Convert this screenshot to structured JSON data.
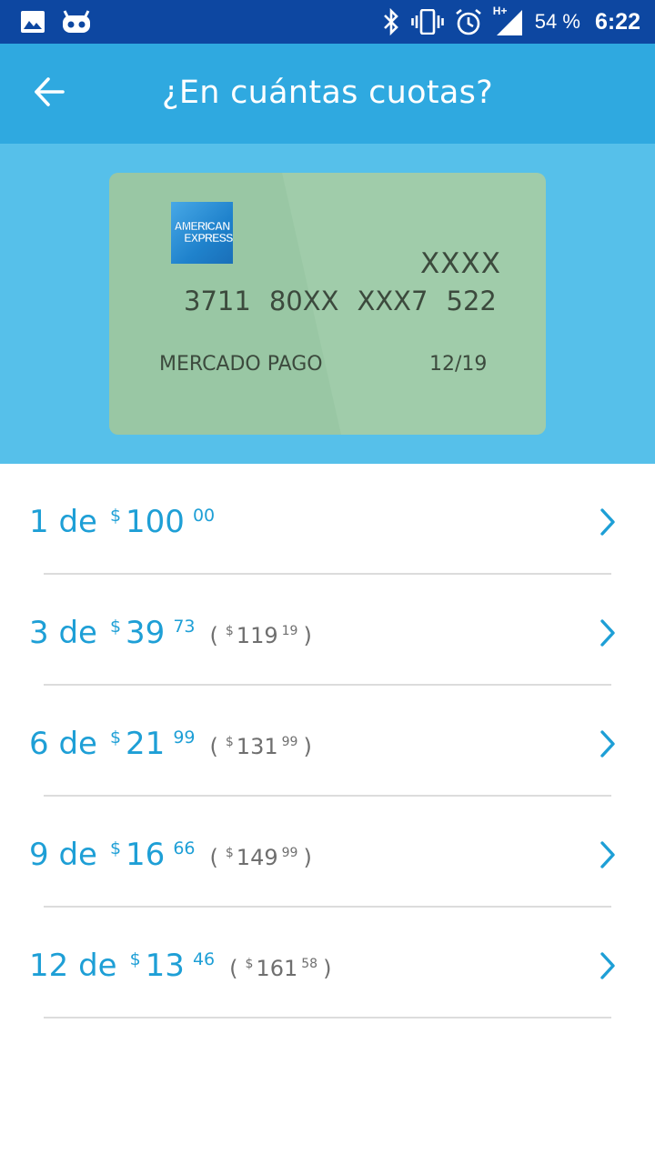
{
  "status_bar": {
    "battery_text": "54 %",
    "time": "6:22",
    "network_label": "H+",
    "icons": [
      "image-icon",
      "cyanogen-icon",
      "bluetooth-icon",
      "vibrate-icon",
      "alarm-icon",
      "signal-icon"
    ]
  },
  "app_bar": {
    "title": "¿En cuántas cuotas?",
    "back_icon": "arrow-left-icon"
  },
  "card": {
    "brand_line1": "AMERICAN",
    "brand_line2": "EXPRESS",
    "security_code": "XXXX",
    "number_groups": [
      "3711",
      "80XX",
      "XXX7",
      "522"
    ],
    "holder": "MERCADO PAGO",
    "expiry": "12/19",
    "color": "#a0ccaa"
  },
  "installments": [
    {
      "count": "1 de",
      "currency": "$",
      "amount": "100",
      "cents": "00"
    },
    {
      "count": "3 de",
      "currency": "$",
      "amount": "39",
      "cents": "73",
      "total_open": "(",
      "total_currency": "$",
      "total_amount": "119",
      "total_cents": "19",
      "total_close": ")"
    },
    {
      "count": "6 de",
      "currency": "$",
      "amount": "21",
      "cents": "99",
      "total_open": "(",
      "total_currency": "$",
      "total_amount": "131",
      "total_cents": "99",
      "total_close": ")"
    },
    {
      "count": "9 de",
      "currency": "$",
      "amount": "16",
      "cents": "66",
      "total_open": "(",
      "total_currency": "$",
      "total_amount": "149",
      "total_cents": "99",
      "total_close": ")"
    },
    {
      "count": "12 de",
      "currency": "$",
      "amount": "13",
      "cents": "46",
      "total_open": "(",
      "total_currency": "$",
      "total_amount": "161",
      "total_cents": "58",
      "total_close": ")"
    }
  ],
  "colors": {
    "status_bar": "#0d47a1",
    "app_bar": "#2fa9e0",
    "card_region": "#56c0ea",
    "accent": "#1e9fd6",
    "secondary_text": "#6f6f6f",
    "divider": "#dcdcdc"
  }
}
